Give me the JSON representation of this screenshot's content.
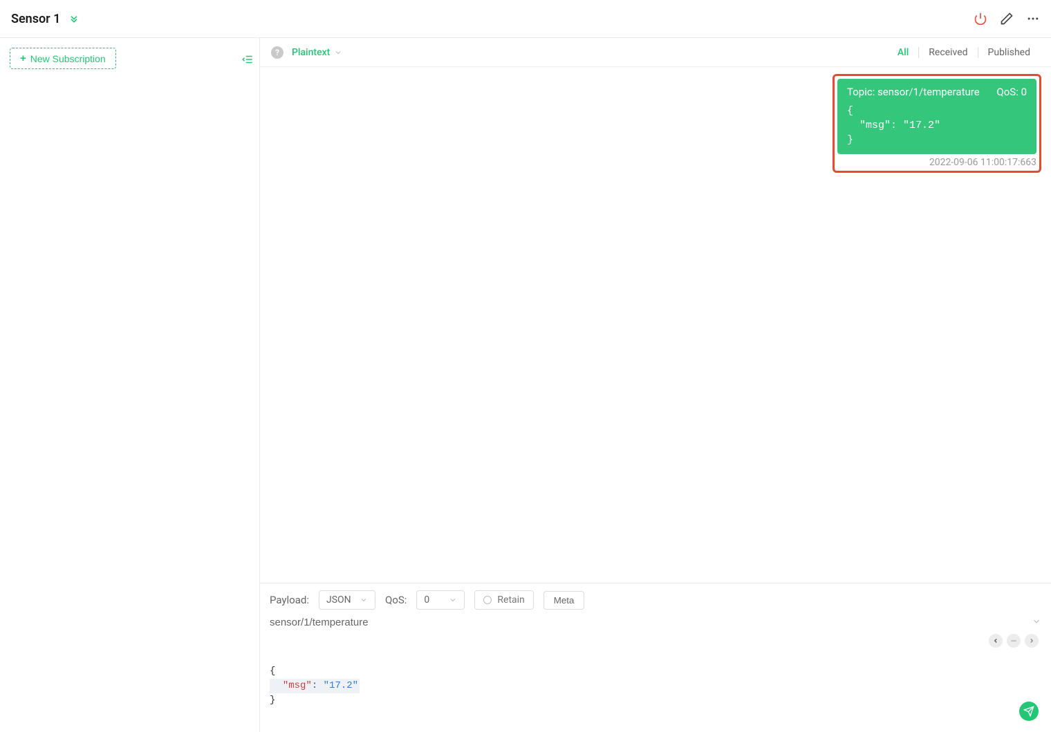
{
  "header": {
    "title": "Sensor 1"
  },
  "sidebar": {
    "newSubscriptionLabel": "New Subscription"
  },
  "topbar": {
    "helpBadge": "?",
    "codec": "Plaintext",
    "filters": {
      "all": "All",
      "received": "Received",
      "published": "Published"
    }
  },
  "message": {
    "topicLabel": "Topic: ",
    "topic": "sensor/1/temperature",
    "qosLabel": "QoS: ",
    "qos": "0",
    "body": "{\n  \"msg\": \"17.2\"\n}",
    "timestamp": "2022-09-06 11:00:17:663"
  },
  "publish": {
    "payloadLabel": "Payload:",
    "payloadType": "JSON",
    "qosLabel": "QoS:",
    "qosValue": "0",
    "retainLabel": "Retain",
    "metaLabel": "Meta",
    "topicValue": "sensor/1/temperature",
    "editor": {
      "line1": "{",
      "line2_key": "\"msg\"",
      "line2_colon": ": ",
      "line2_val": "\"17.2\"",
      "line3": "}"
    }
  }
}
